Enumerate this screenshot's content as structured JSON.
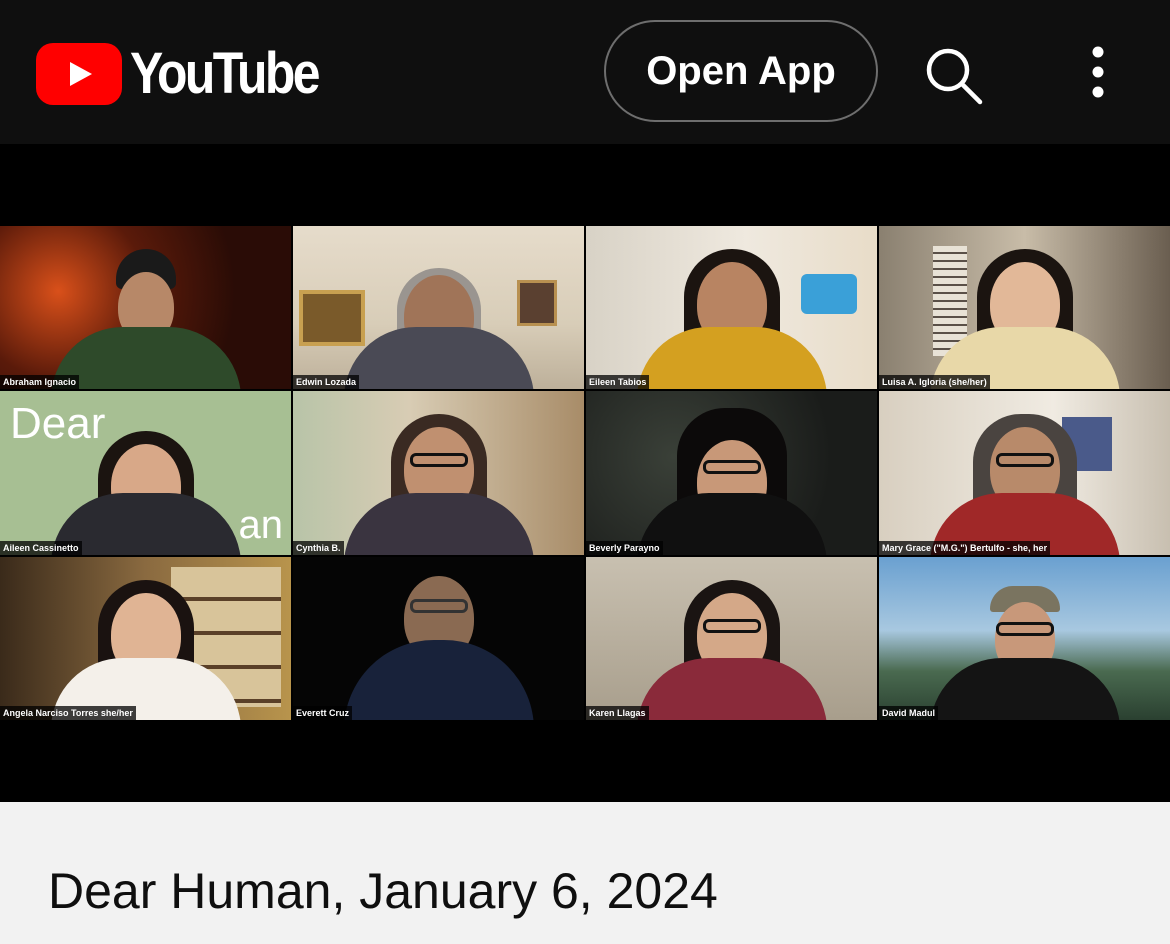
{
  "header": {
    "logo_text": "YouTube",
    "open_app_label": "Open App",
    "search_icon": "search-icon",
    "more_icon": "more-vert-icon"
  },
  "colors": {
    "brand_red": "#ff0000",
    "header_bg": "#0f0f0f",
    "page_bg": "#f2f2f2"
  },
  "video": {
    "book_text_top": "Dear",
    "book_text_bottom": "an",
    "participants": [
      {
        "name": "Abraham Ignacio"
      },
      {
        "name": "Edwin Lozada"
      },
      {
        "name": "Eileen Tabios"
      },
      {
        "name": "Luisa A. Igloria (she/her)"
      },
      {
        "name": "Aileen Cassinetto"
      },
      {
        "name": "Cynthia B."
      },
      {
        "name": "Beverly Parayno"
      },
      {
        "name": "Mary Grace (\"M.G.\") Bertulfo - she, her"
      },
      {
        "name": "Angela Narciso Torres she/her"
      },
      {
        "name": "Everett Cruz"
      },
      {
        "name": "Karen Llagas"
      },
      {
        "name": "David Madul"
      }
    ]
  },
  "title": "Dear Human, January 6, 2024"
}
